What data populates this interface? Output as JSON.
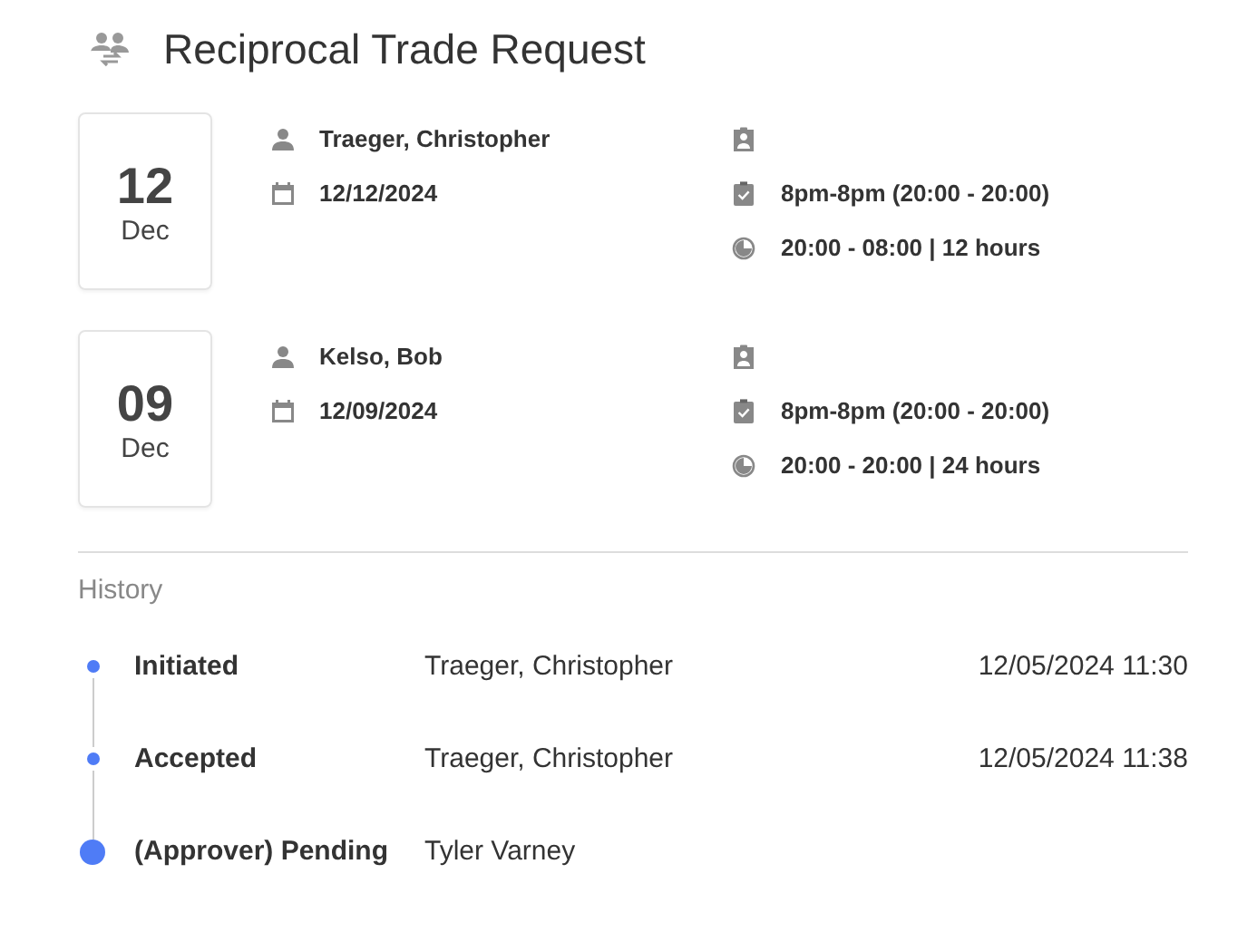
{
  "title": "Reciprocal Trade Request",
  "shifts": [
    {
      "day": "12",
      "month": "Dec",
      "person": "Traeger, Christopher",
      "date": "12/12/2024",
      "shift": "8pm-8pm (20:00 - 20:00)",
      "hours": "20:00 - 08:00 | 12 hours"
    },
    {
      "day": "09",
      "month": "Dec",
      "person": "Kelso, Bob",
      "date": "12/09/2024",
      "shift": "8pm-8pm (20:00 - 20:00)",
      "hours": "20:00 - 20:00 | 24 hours"
    }
  ],
  "history": {
    "heading": "History",
    "steps": [
      {
        "status": "Initiated",
        "person": "Traeger, Christopher",
        "time": "12/05/2024 11:30",
        "current": false
      },
      {
        "status": "Accepted",
        "person": "Traeger, Christopher",
        "time": "12/05/2024 11:38",
        "current": false
      },
      {
        "status": "(Approver) Pending",
        "person": "Tyler Varney",
        "current": true
      }
    ]
  }
}
